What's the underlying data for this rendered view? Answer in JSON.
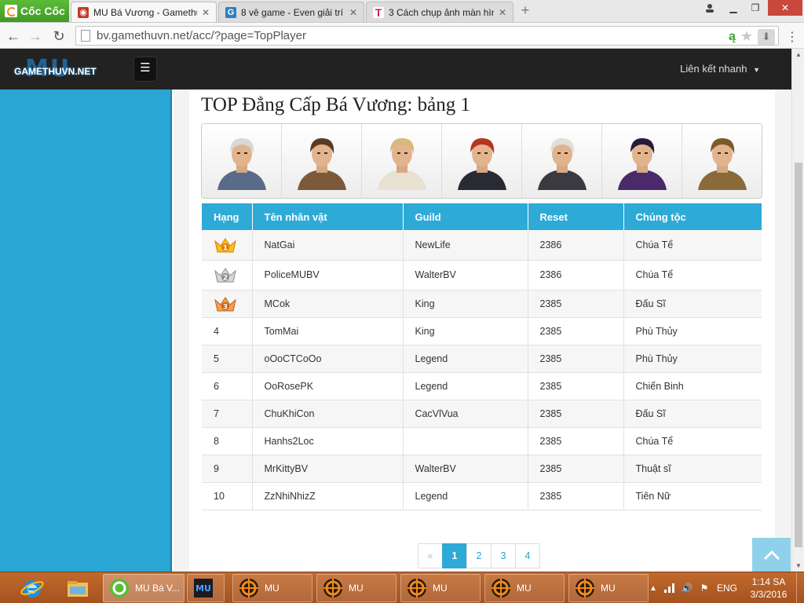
{
  "browser": {
    "brand_label": "Cốc Cốc",
    "tabs": [
      {
        "label": "MU Bá Vương - Gamethuvn",
        "active": true
      },
      {
        "label": "8 vê game - Even giải trí c",
        "active": false
      },
      {
        "label": "3 Cách chụp ảnh màn hình",
        "active": false
      }
    ],
    "address": "bv.gamethuvn.net/acc/?page=TopPlayer"
  },
  "site": {
    "logo_big": "MU",
    "logo_small": "GAMETHUVN.NET",
    "quick_links_label": "Liên kết nhanh"
  },
  "main": {
    "title": "TOP Đẳng Cấp Bá Vương: bảng 1",
    "character_classes": [
      {
        "icon": "dark-knight-portrait",
        "hair": "#d8d8d8",
        "outfit": "#5a6b8a"
      },
      {
        "icon": "dark-wizard-portrait",
        "hair": "#5a3a22",
        "outfit": "#7a5a3a"
      },
      {
        "icon": "fairy-elf-portrait",
        "hair": "#d9b97a",
        "outfit": "#e8e0d0"
      },
      {
        "icon": "magic-gladiator-portrait",
        "hair": "#b8341e",
        "outfit": "#2a2a35"
      },
      {
        "icon": "dark-lord-portrait",
        "hair": "#e0e0d8",
        "outfit": "#3a3a40"
      },
      {
        "icon": "summoner-portrait",
        "hair": "#2a1a3a",
        "outfit": "#4a2a6a"
      },
      {
        "icon": "rage-fighter-portrait",
        "hair": "#7a5a2a",
        "outfit": "#8a6a3a"
      }
    ],
    "table": {
      "headers": [
        "Hạng",
        "Tên nhân vật",
        "Guild",
        "Reset",
        "Chủng tộc"
      ],
      "rows": [
        {
          "rank": "1",
          "name": "NatGai",
          "guild": "NewLife",
          "reset": "2386",
          "race": "Chúa Tể",
          "race_class": "cls-chua"
        },
        {
          "rank": "2",
          "name": "PoliceMUBV",
          "guild": "WalterBV",
          "reset": "2386",
          "race": "Chúa Tể",
          "race_class": "cls-chua"
        },
        {
          "rank": "3",
          "name": "MCok",
          "guild": "King",
          "reset": "2385",
          "race": "Đấu Sĩ",
          "race_class": "cls-dau"
        },
        {
          "rank": "4",
          "name": "TomMai",
          "guild": "King",
          "reset": "2385",
          "race": "Phù Thủy",
          "race_class": "cls-phu"
        },
        {
          "rank": "5",
          "name": "oOoCTCoOo",
          "guild": "Legend",
          "reset": "2385",
          "race": "Phù Thủy",
          "race_class": "cls-phu"
        },
        {
          "rank": "6",
          "name": "OoRosePK",
          "guild": "Legend",
          "reset": "2385",
          "race": "Chiến Binh",
          "race_class": "cls-chien"
        },
        {
          "rank": "7",
          "name": "ChuKhiCon",
          "guild": "CacVlVua",
          "reset": "2385",
          "race": "Đấu Sĩ",
          "race_class": "cls-dau"
        },
        {
          "rank": "8",
          "name": "Hanhs2Loc",
          "guild": "",
          "reset": "2385",
          "race": "Chúa Tể",
          "race_class": "cls-chua"
        },
        {
          "rank": "9",
          "name": "MrKittyBV",
          "guild": "WalterBV",
          "reset": "2385",
          "race": "Thuật sĩ",
          "race_class": "cls-thuat"
        },
        {
          "rank": "10",
          "name": "ZzNhiNhizZ",
          "guild": "Legend",
          "reset": "2385",
          "race": "Tiên Nữ",
          "race_class": "cls-tien"
        }
      ]
    },
    "pagination": {
      "prev": "«",
      "pages": [
        "1",
        "2",
        "3",
        "4"
      ],
      "current": "1"
    }
  },
  "taskbar": {
    "items": [
      {
        "label": "MU Bá V...",
        "active": true
      },
      {
        "label": "",
        "active": false
      },
      {
        "label": "MU",
        "active": false
      },
      {
        "label": "MU",
        "active": false
      },
      {
        "label": "MU",
        "active": false
      },
      {
        "label": "MU",
        "active": false
      },
      {
        "label": "MU",
        "active": false
      }
    ],
    "lang": "ENG",
    "time": "1:14 SA",
    "date": "3/3/2016"
  },
  "colors": {
    "accent": "#2eaad6",
    "left_panel": "#2aa6d4",
    "taskbar": "#b35e25"
  }
}
